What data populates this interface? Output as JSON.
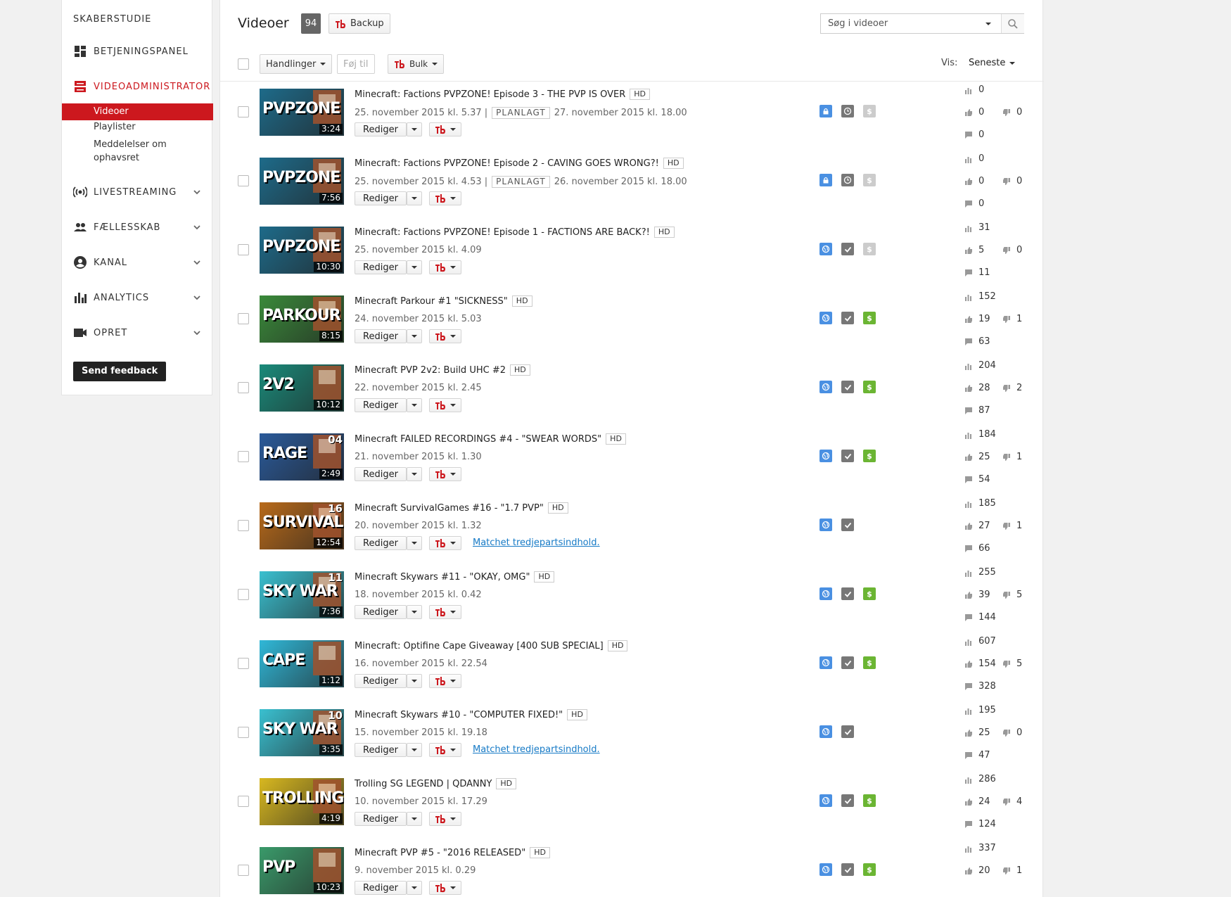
{
  "sidebar": {
    "title": "SKABERSTUDIE",
    "dashboard": "BETJENINGSPANEL",
    "videomanager": "VIDEOADMINISTRATOR",
    "sub": [
      "Videoer",
      "Playlister",
      "Meddelelser om ophavsret"
    ],
    "sections": [
      "LIVESTREAMING",
      "FÆLLESSKAB",
      "KANAL",
      "ANALYTICS",
      "OPRET"
    ],
    "feedback": "Send feedback"
  },
  "header": {
    "title": "Videoer",
    "count": "94",
    "backup": "Backup",
    "search_placeholder": "Søg i videoer"
  },
  "toolbar": {
    "actions": "Handlinger",
    "add_to": "Føj til",
    "bulk": "Bulk",
    "view_label": "Vis:",
    "view_value": "Seneste"
  },
  "row_labels": {
    "edit": "Rediger",
    "hd": "HD",
    "scheduled": "PLANLAGT",
    "match": "Matchet tredjepartsindhold."
  },
  "colors": {
    "accent": "#cc181e",
    "public": "#4a90e2",
    "monetized": "#6bb533"
  },
  "videos": [
    {
      "title": "Minecraft: Factions PVPZONE! Episode 3 - THE PVP IS OVER",
      "date": "25. november 2015 kl. 5.37 |",
      "scheduled": true,
      "sched_date": "27. november 2015 kl. 18.00",
      "duration": "3:24",
      "thumb": "PVPZONE",
      "thumb_bg": "#1e6b8a",
      "views": "0",
      "likes": "0",
      "dislikes": "0",
      "comments": "0",
      "privacy": "lock-icon",
      "money": false,
      "match": false
    },
    {
      "title": "Minecraft: Factions PVPZONE! Episode 2 - CAVING GOES WRONG?!",
      "date": "25. november 2015 kl. 4.53 |",
      "scheduled": true,
      "sched_date": "26. november 2015 kl. 18.00",
      "duration": "7:56",
      "thumb": "PVPZONE",
      "thumb_bg": "#1e6b8a",
      "views": "0",
      "likes": "0",
      "dislikes": "0",
      "comments": "0",
      "privacy": "lock-icon",
      "money": false,
      "match": false
    },
    {
      "title": "Minecraft: Factions PVPZONE! Episode 1 - FACTIONS ARE BACK?!",
      "date": "25. november 2015 kl. 4.09",
      "scheduled": false,
      "sched_date": "",
      "duration": "10:30",
      "thumb": "PVPZONE",
      "thumb_bg": "#1e6b8a",
      "views": "31",
      "likes": "5",
      "dislikes": "0",
      "comments": "11",
      "privacy": "globe-icon",
      "money": false,
      "match": false
    },
    {
      "title": "Minecraft Parkour #1 \"SICKNESS\"",
      "date": "24. november 2015 kl. 5.03",
      "scheduled": false,
      "sched_date": "",
      "duration": "8:15",
      "thumb": "PARKOUR",
      "thumb_bg": "#3a8a3a",
      "views": "152",
      "likes": "19",
      "dislikes": "1",
      "comments": "63",
      "privacy": "globe-icon",
      "money": true,
      "match": false
    },
    {
      "title": "Minecraft PVP 2v2: Build UHC #2",
      "date": "22. november 2015 kl. 2.45",
      "scheduled": false,
      "sched_date": "",
      "duration": "10:12",
      "thumb": "2V2",
      "thumb_bg": "#1a8a7a",
      "views": "204",
      "likes": "28",
      "dislikes": "2",
      "comments": "87",
      "privacy": "globe-icon",
      "money": true,
      "match": false
    },
    {
      "title": "Minecraft FAILED RECORDINGS #4 - \"SWEAR WORDS\"",
      "date": "21. november 2015 kl. 1.30",
      "scheduled": false,
      "sched_date": "",
      "duration": "2:49",
      "thumb": "RAGE",
      "thumb_bg": "#2a5a9a",
      "views": "184",
      "likes": "25",
      "dislikes": "1",
      "comments": "54",
      "privacy": "globe-icon",
      "money": true,
      "match": false,
      "num": "04"
    },
    {
      "title": "Minecraft SurvivalGames #16 - \"1.7 PVP\"",
      "date": "20. november 2015 kl. 1.32",
      "scheduled": false,
      "sched_date": "",
      "duration": "12:54",
      "thumb": "SURVIVAL",
      "thumb_bg": "#b86a1a",
      "views": "185",
      "likes": "27",
      "dislikes": "1",
      "comments": "66",
      "privacy": "globe-icon",
      "money": false,
      "match": true,
      "num": "16"
    },
    {
      "title": "Minecraft Skywars #11 - \"OKAY, OMG\"",
      "date": "18. november 2015 kl. 0.42",
      "scheduled": false,
      "sched_date": "",
      "duration": "7:36",
      "thumb": "SKY WAR",
      "thumb_bg": "#3ac0d0",
      "views": "255",
      "likes": "39",
      "dislikes": "5",
      "comments": "144",
      "privacy": "globe-icon",
      "money": true,
      "match": false,
      "num": "11"
    },
    {
      "title": "Minecraft: Optifine Cape Giveaway [400 SUB SPECIAL]",
      "date": "16. november 2015 kl. 22.54",
      "scheduled": false,
      "sched_date": "",
      "duration": "1:12",
      "thumb": "CAPE",
      "thumb_bg": "#30b8d8",
      "views": "607",
      "likes": "154",
      "dislikes": "5",
      "comments": "328",
      "privacy": "globe-icon",
      "money": true,
      "match": false
    },
    {
      "title": "Minecraft Skywars #10 - \"COMPUTER FIXED!\"",
      "date": "15. november 2015 kl. 19.18",
      "scheduled": false,
      "sched_date": "",
      "duration": "3:35",
      "thumb": "SKY WAR",
      "thumb_bg": "#3ac0d0",
      "views": "195",
      "likes": "25",
      "dislikes": "0",
      "comments": "47",
      "privacy": "globe-icon",
      "money": false,
      "match": true,
      "num": "10"
    },
    {
      "title": "Trolling SG LEGEND | QDANNY",
      "date": "10. november 2015 kl. 17.29",
      "scheduled": false,
      "sched_date": "",
      "duration": "4:19",
      "thumb": "TROLLING",
      "thumb_bg": "#d8b820",
      "views": "286",
      "likes": "24",
      "dislikes": "4",
      "comments": "124",
      "privacy": "globe-icon",
      "money": true,
      "match": false
    },
    {
      "title": "Minecraft PVP #5 - \"2016 RELEASED\"",
      "date": "9. november 2015 kl. 0.29",
      "scheduled": false,
      "sched_date": "",
      "duration": "10:23",
      "thumb": "PVP",
      "thumb_bg": "#3a9a6a",
      "views": "337",
      "likes": "20",
      "dislikes": "1",
      "comments": "",
      "privacy": "globe-icon",
      "money": true,
      "match": false
    }
  ]
}
